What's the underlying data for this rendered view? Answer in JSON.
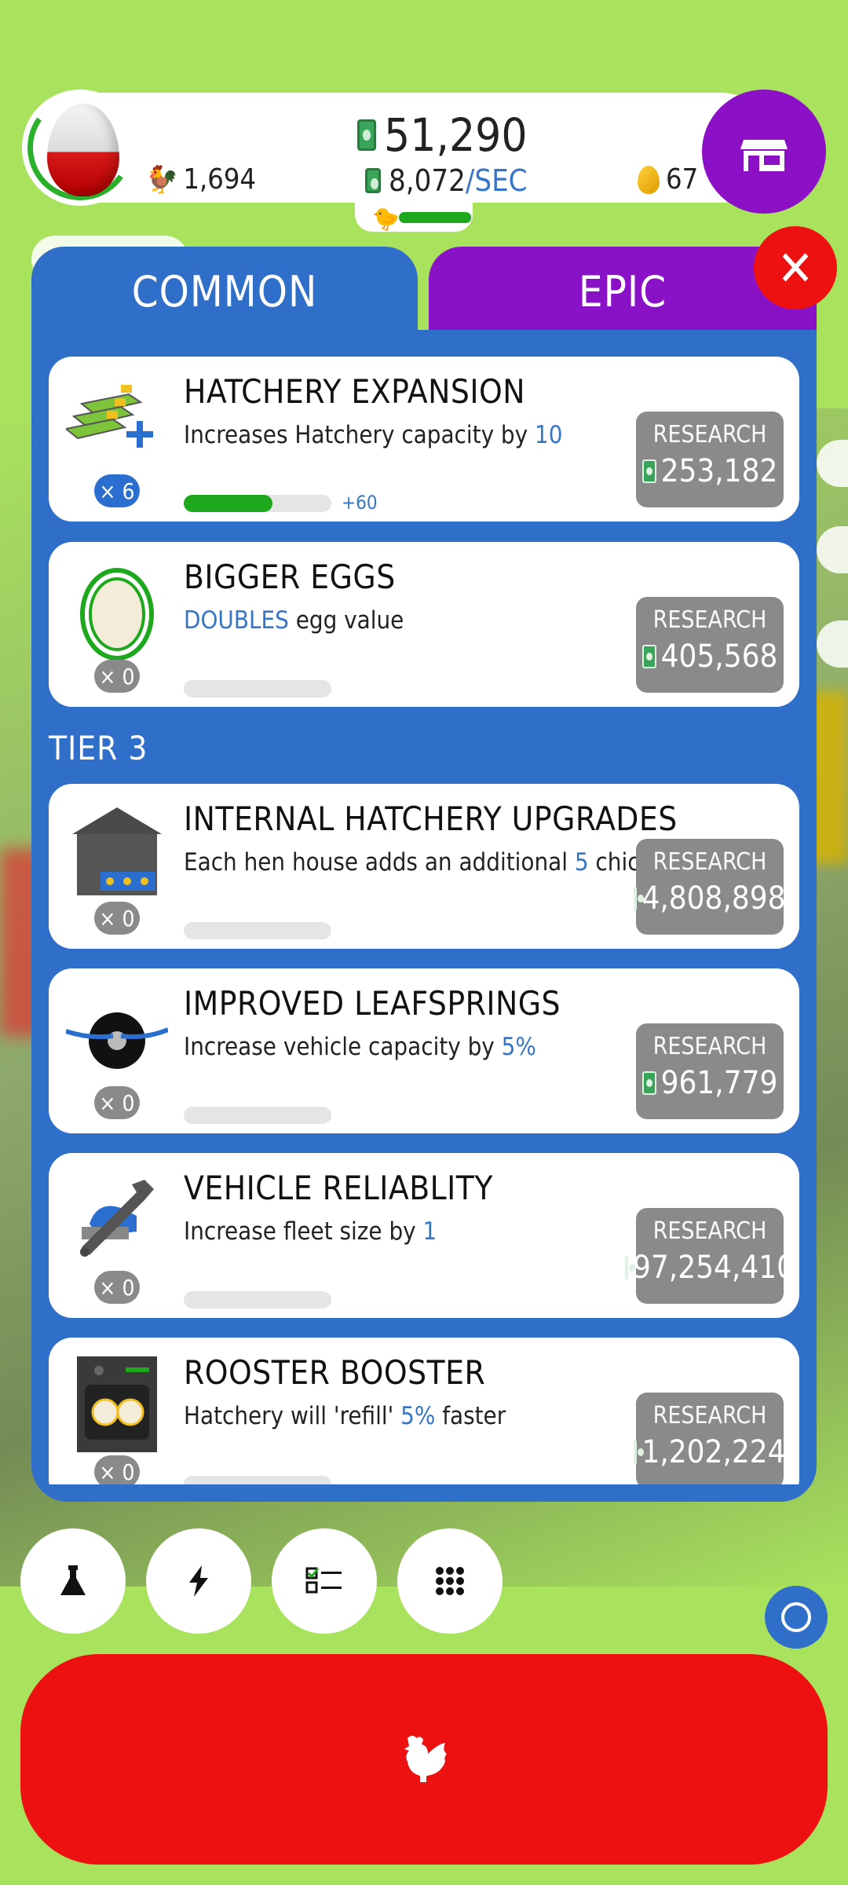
{
  "header": {
    "cash": "51,290",
    "cash_rate": "8,072",
    "cash_rate_unit": "/SEC",
    "chicken_count": "1,694",
    "golden_eggs": "67",
    "hatchery_fill": 0.98
  },
  "tabs": [
    {
      "label": "COMMON",
      "selected": true
    },
    {
      "label": "EPIC",
      "selected": false
    }
  ],
  "research_label": "RESEARCH",
  "tier3_label": "TIER 3",
  "cards": [
    {
      "title": "HATCHERY EXPANSION",
      "desc_pre": "Increases Hatchery capacity by ",
      "desc_hl": "10",
      "desc_post": "",
      "count": "× 6",
      "progress": 0.6,
      "progress_note": "+60",
      "price": "253,182"
    },
    {
      "title": "BIGGER EGGS",
      "desc_pre": "",
      "desc_hl": "DOUBLES",
      "desc_post": " egg value",
      "count": "× 0",
      "progress": 0,
      "progress_note": "",
      "price": "405,568"
    },
    {
      "title": "INTERNAL HATCHERY UPGRADES",
      "desc_pre": "Each hen house adds an additional ",
      "desc_hl": "5",
      "desc_post": " chickens/min",
      "count": "× 0",
      "progress": 0,
      "progress_note": "",
      "price": "4,808,898"
    },
    {
      "title": "IMPROVED LEAFSPRINGS",
      "desc_pre": "Increase vehicle capacity by ",
      "desc_hl": "5%",
      "desc_post": "",
      "count": "× 0",
      "progress": 0,
      "progress_note": "",
      "price": "961,779"
    },
    {
      "title": "VEHICLE RELIABLITY",
      "desc_pre": "Increase fleet size by ",
      "desc_hl": "1",
      "desc_post": "",
      "count": "× 0",
      "progress": 0,
      "progress_note": "",
      "price": "97,254,410"
    },
    {
      "title": "ROOSTER BOOSTER",
      "desc_pre": "Hatchery will 'refill' ",
      "desc_hl": "5%",
      "desc_post": " faster",
      "count": "× 0",
      "progress": 0,
      "progress_note": "",
      "price": "1,202,224"
    }
  ],
  "icons": {
    "bottom": [
      "flask-icon",
      "lightning-icon",
      "checklist-icon",
      "grid-icon"
    ],
    "main_action": "chicken-icon"
  },
  "colors": {
    "blue": "#2f6fc9",
    "purple": "#8a12c6",
    "red": "#ee1111",
    "green": "#1ea81e"
  }
}
